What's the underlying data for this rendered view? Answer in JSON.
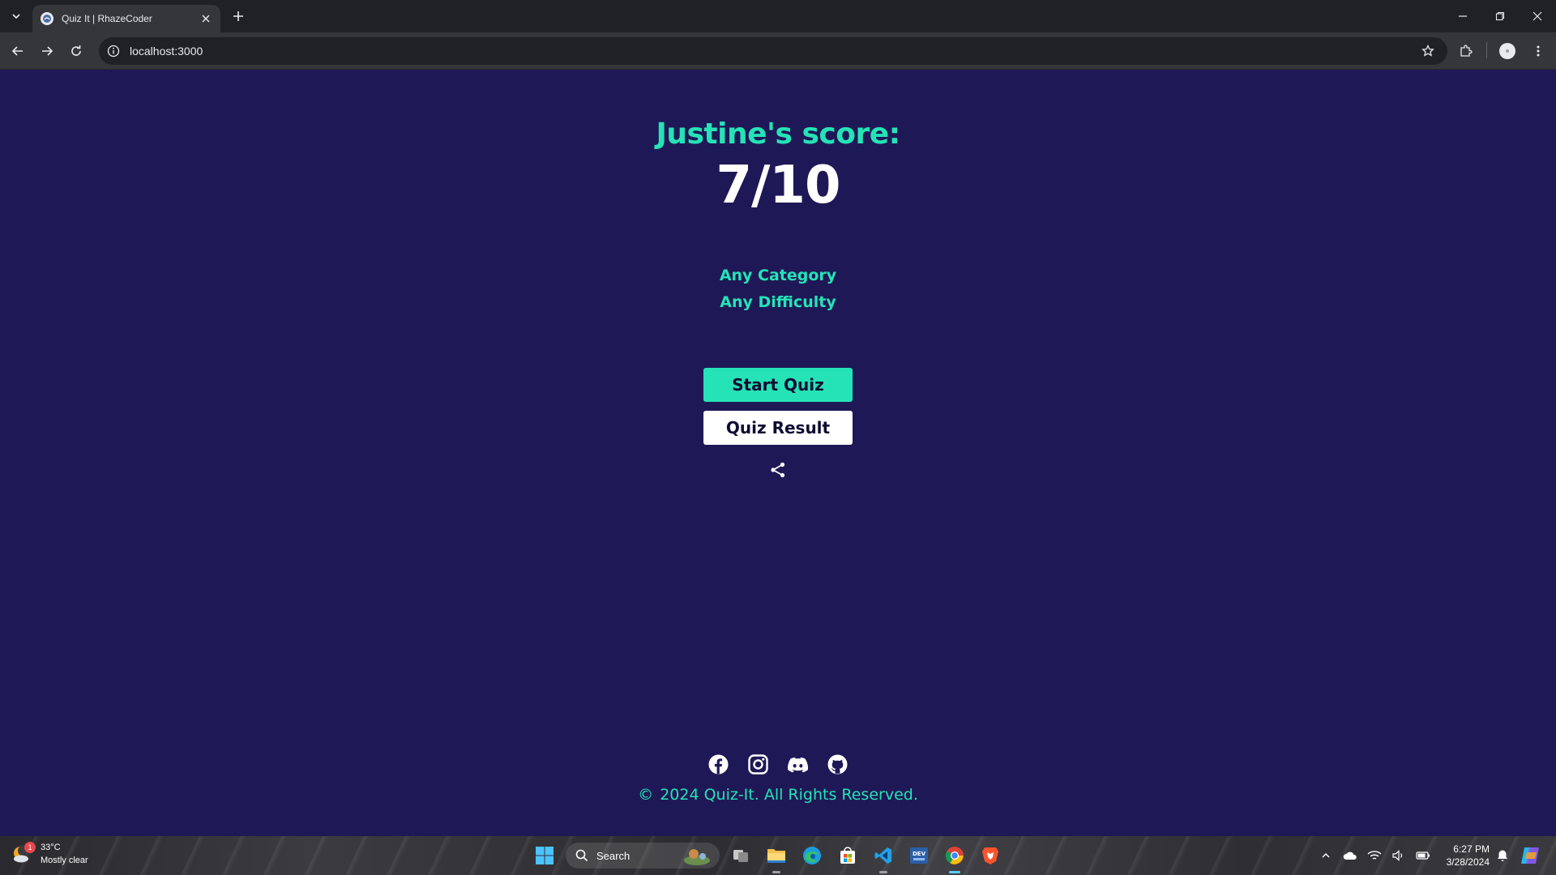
{
  "browser": {
    "tab_title": "Quiz It | RhazeCoder",
    "url": "localhost:3000"
  },
  "quiz": {
    "score_heading": "Justine's score:",
    "score_value": "7/10",
    "category": "Any Category",
    "difficulty": "Any Difficulty",
    "start_label": "Start Quiz",
    "result_label": "Quiz Result"
  },
  "footer": {
    "copyright_symbol": "©",
    "copyright_text": "2024 Quiz-It. All Rights Reserved.",
    "socials": [
      "facebook-icon",
      "instagram-icon",
      "discord-icon",
      "github-icon"
    ]
  },
  "taskbar": {
    "weather_badge": "1",
    "weather_temp": "33°C",
    "weather_desc": "Mostly clear",
    "search_placeholder": "Search",
    "time": "6:27 PM",
    "date": "3/28/2024"
  },
  "colors": {
    "page_bg": "#1f1856",
    "accent": "#25e3b6",
    "button_text": "#0f0c33"
  }
}
